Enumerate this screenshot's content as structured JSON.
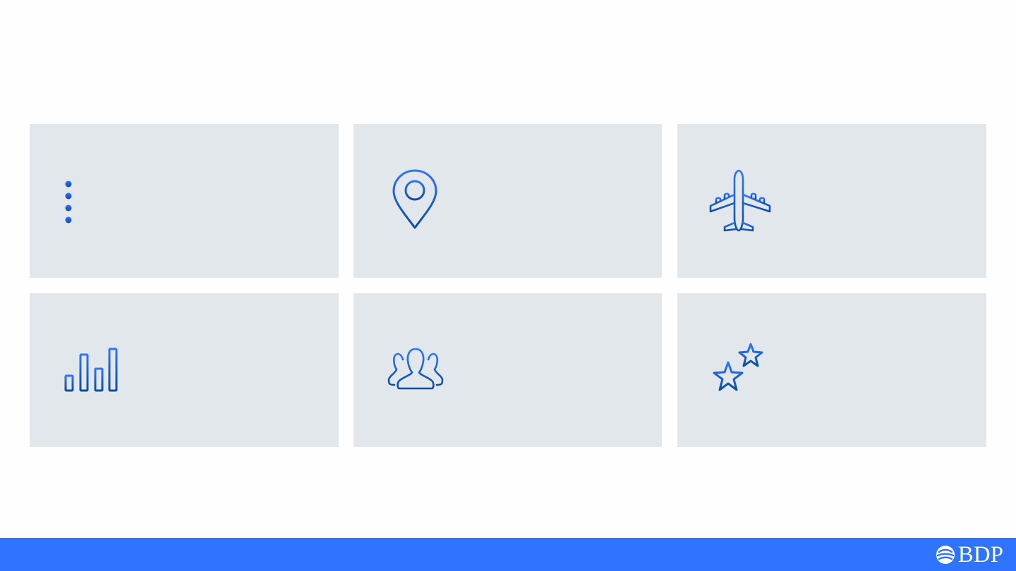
{
  "colors": {
    "background": "#fefefe",
    "card_background": "#e2e7ec",
    "icon_gradient_top": "#2f74fe",
    "icon_gradient_bottom": "#0d4ea2",
    "footer_background": "#2f74fe",
    "logo_color": "#ffffff"
  },
  "cards": [
    {
      "icon": "list-icon"
    },
    {
      "icon": "location-pin-icon"
    },
    {
      "icon": "airplane-icon"
    },
    {
      "icon": "bar-chart-icon"
    },
    {
      "icon": "people-group-icon"
    },
    {
      "icon": "stars-icon"
    }
  ],
  "footer": {
    "logo_text": "BDP",
    "logo_icon": "bdp-globe-icon"
  }
}
